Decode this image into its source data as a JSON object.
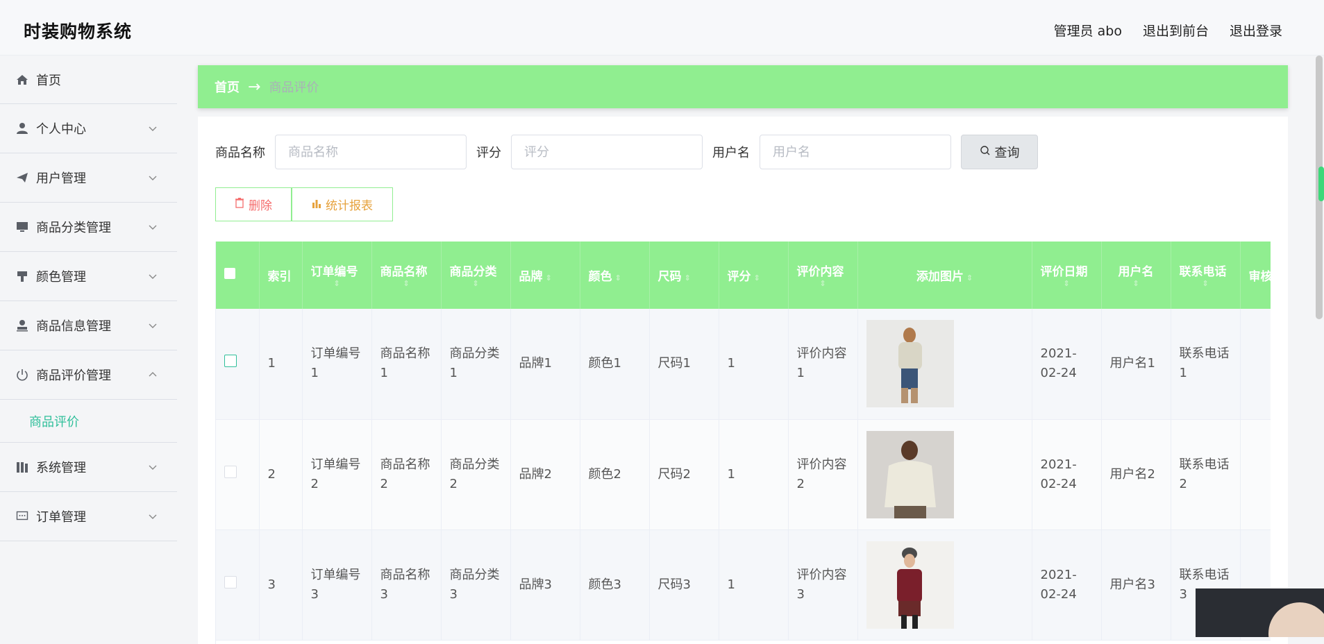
{
  "header": {
    "app_title": "时装购物系统",
    "admin_label": "管理员 abo",
    "front_label": "退出到前台",
    "logout_label": "退出登录"
  },
  "sidebar": {
    "items": [
      {
        "label": "首页",
        "icon": "home-icon"
      },
      {
        "label": "个人中心",
        "icon": "user-icon"
      },
      {
        "label": "用户管理",
        "icon": "paper-plane-icon"
      },
      {
        "label": "商品分类管理",
        "icon": "monitor-icon"
      },
      {
        "label": "颜色管理",
        "icon": "brush-icon"
      },
      {
        "label": "商品信息管理",
        "icon": "stamp-icon"
      },
      {
        "label": "商品评价管理",
        "icon": "power-icon"
      },
      {
        "label": "系统管理",
        "icon": "books-icon"
      },
      {
        "label": "订单管理",
        "icon": "chat-icon"
      }
    ],
    "active_sub": "商品评价"
  },
  "breadcrumb": {
    "home": "首页",
    "current": "商品评价"
  },
  "search": {
    "product_label": "商品名称",
    "product_placeholder": "商品名称",
    "rating_label": "评分",
    "rating_placeholder": "评分",
    "user_label": "用户名",
    "user_placeholder": "用户名",
    "query_label": "查询"
  },
  "actions": {
    "delete_label": "删除",
    "stats_label": "统计报表"
  },
  "table": {
    "headers": [
      "索引",
      "订单编号",
      "商品名称",
      "商品分类",
      "品牌",
      "颜色",
      "尺码",
      "评分",
      "评价内容",
      "添加图片",
      "评价日期",
      "用户名",
      "联系电话",
      "审核"
    ],
    "rows": [
      {
        "index": "1",
        "order_no": "订单编号1",
        "product": "商品名称1",
        "category": "商品分类1",
        "brand": "品牌1",
        "color": "颜色1",
        "size": "尺码1",
        "rating": "1",
        "content": "评价内容1",
        "date": "2021-02-24",
        "user": "用户名1",
        "phone": "联系电话1"
      },
      {
        "index": "2",
        "order_no": "订单编号2",
        "product": "商品名称2",
        "category": "商品分类2",
        "brand": "品牌2",
        "color": "颜色2",
        "size": "尺码2",
        "rating": "1",
        "content": "评价内容2",
        "date": "2021-02-24",
        "user": "用户名2",
        "phone": "联系电话2"
      },
      {
        "index": "3",
        "order_no": "订单编号3",
        "product": "商品名称3",
        "category": "商品分类3",
        "brand": "品牌3",
        "color": "颜色3",
        "size": "尺码3",
        "rating": "1",
        "content": "评价内容3",
        "date": "2021-02-24",
        "user": "用户名3",
        "phone": "联系电话3"
      }
    ]
  },
  "colors": {
    "accent_green": "#90ee90",
    "active_teal": "#2fbf9a",
    "delete_red": "#f56c6c",
    "stats_orange": "#e6a23c"
  }
}
